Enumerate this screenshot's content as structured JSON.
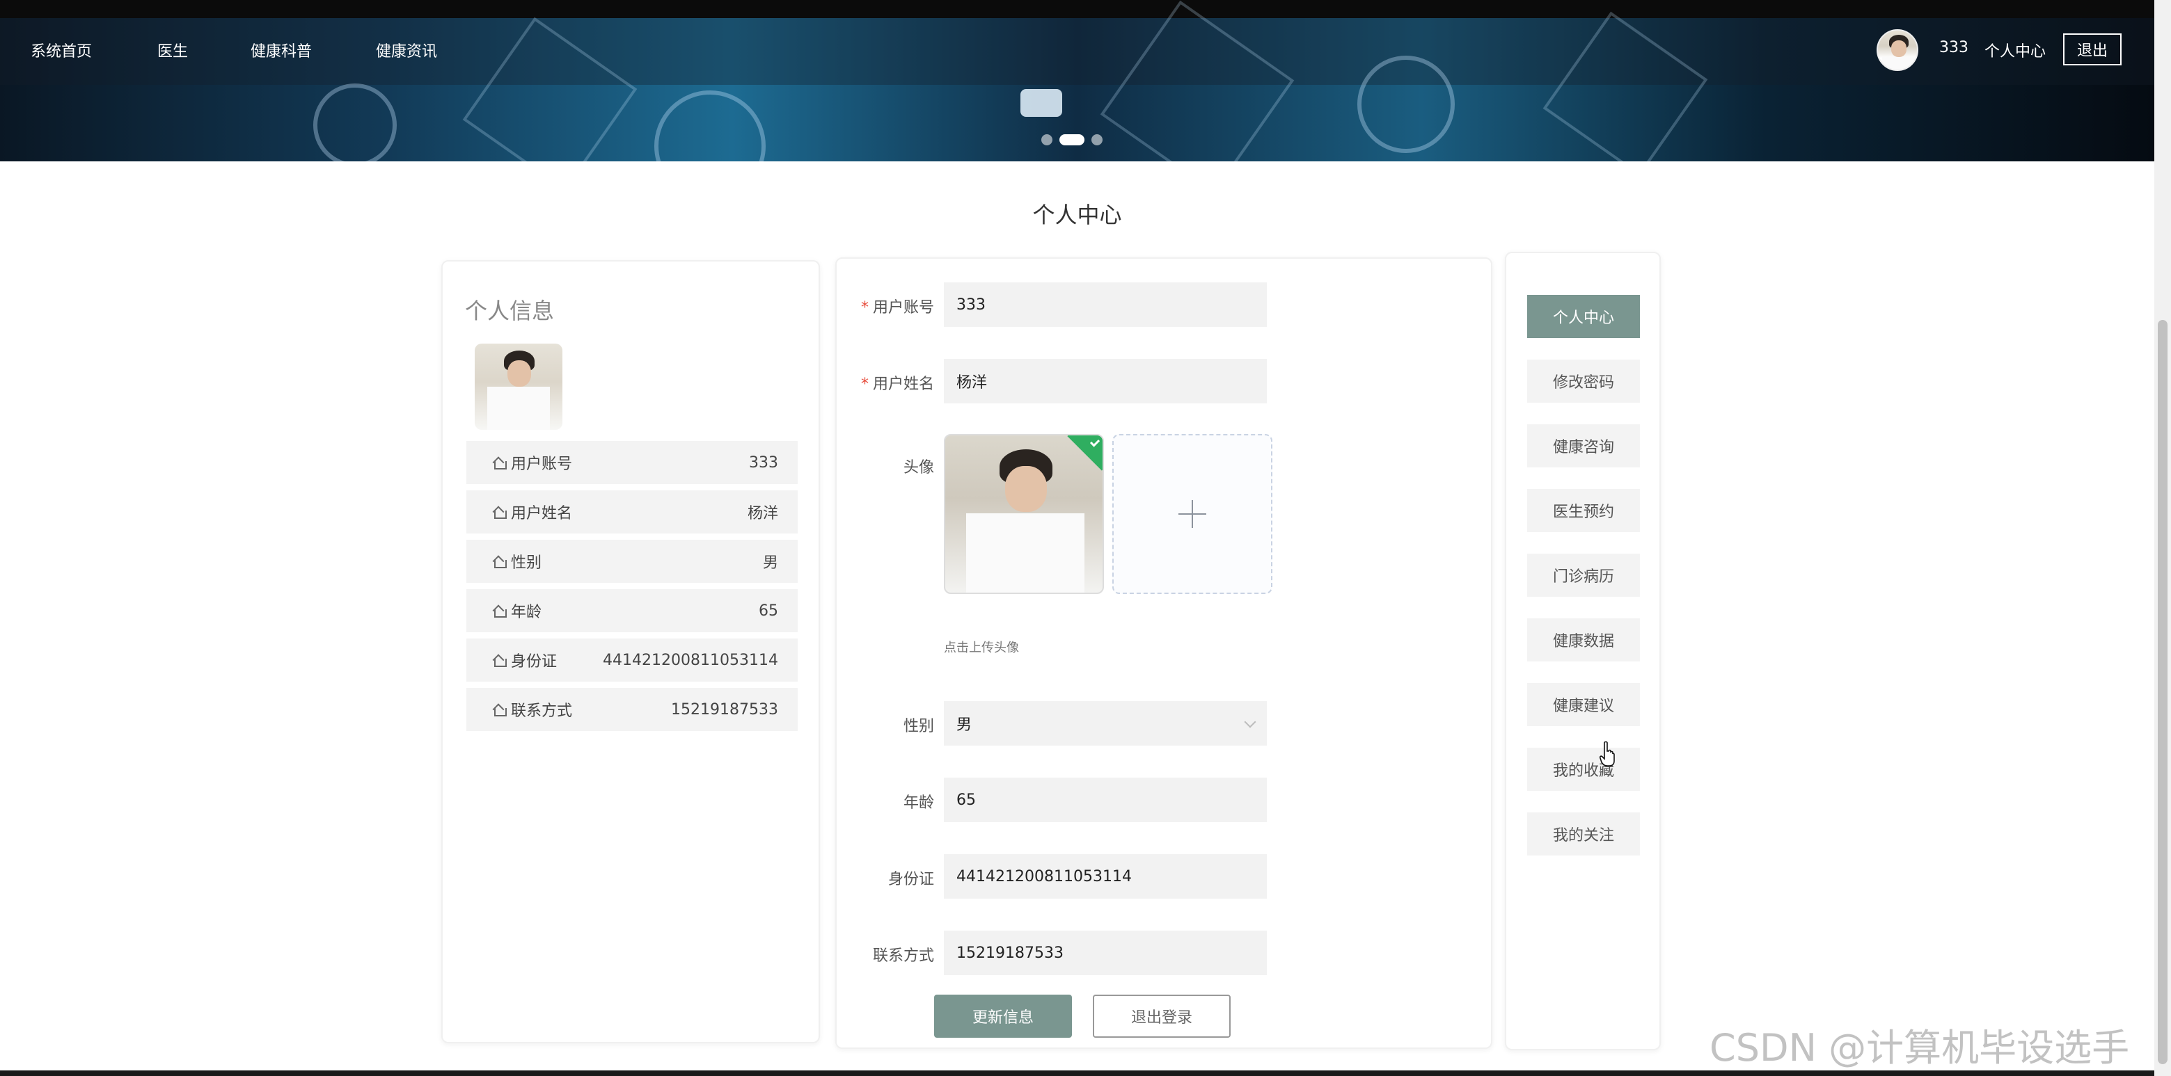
{
  "nav": {
    "items": [
      {
        "label": "系统首页"
      },
      {
        "label": "医生"
      },
      {
        "label": "健康科普"
      },
      {
        "label": "健康资讯"
      }
    ],
    "username": "333",
    "center_label": "个人中心",
    "logout_label": "退出"
  },
  "page_title": "个人中心",
  "info": {
    "title": "个人信息",
    "rows": [
      {
        "label": "用户账号",
        "value": "333"
      },
      {
        "label": "用户姓名",
        "value": "杨洋"
      },
      {
        "label": "性别",
        "value": "男"
      },
      {
        "label": "年龄",
        "value": "65"
      },
      {
        "label": "身份证",
        "value": "441421200811053114"
      },
      {
        "label": "联系方式",
        "value": "15219187533"
      }
    ]
  },
  "form": {
    "account": {
      "label": "用户账号",
      "value": "333"
    },
    "name": {
      "label": "用户姓名",
      "value": "杨洋"
    },
    "avatar": {
      "label": "头像",
      "hint": "点击上传头像"
    },
    "gender": {
      "label": "性别",
      "value": "男"
    },
    "age": {
      "label": "年龄",
      "value": "65"
    },
    "id_card": {
      "label": "身份证",
      "value": "441421200811053114"
    },
    "phone": {
      "label": "联系方式",
      "value": "15219187533"
    },
    "update_label": "更新信息",
    "logout_label": "退出登录"
  },
  "side_menu": {
    "items": [
      {
        "label": "个人中心"
      },
      {
        "label": "修改密码"
      },
      {
        "label": "健康咨询"
      },
      {
        "label": "医生预约"
      },
      {
        "label": "门诊病历"
      },
      {
        "label": "健康数据"
      },
      {
        "label": "健康建议"
      },
      {
        "label": "我的收藏"
      },
      {
        "label": "我的关注"
      }
    ]
  },
  "watermark": "CSDN @计算机毕设选手",
  "colors": {
    "accent": "#7a9690",
    "required": "#e74c3c",
    "success": "#2fae60"
  }
}
